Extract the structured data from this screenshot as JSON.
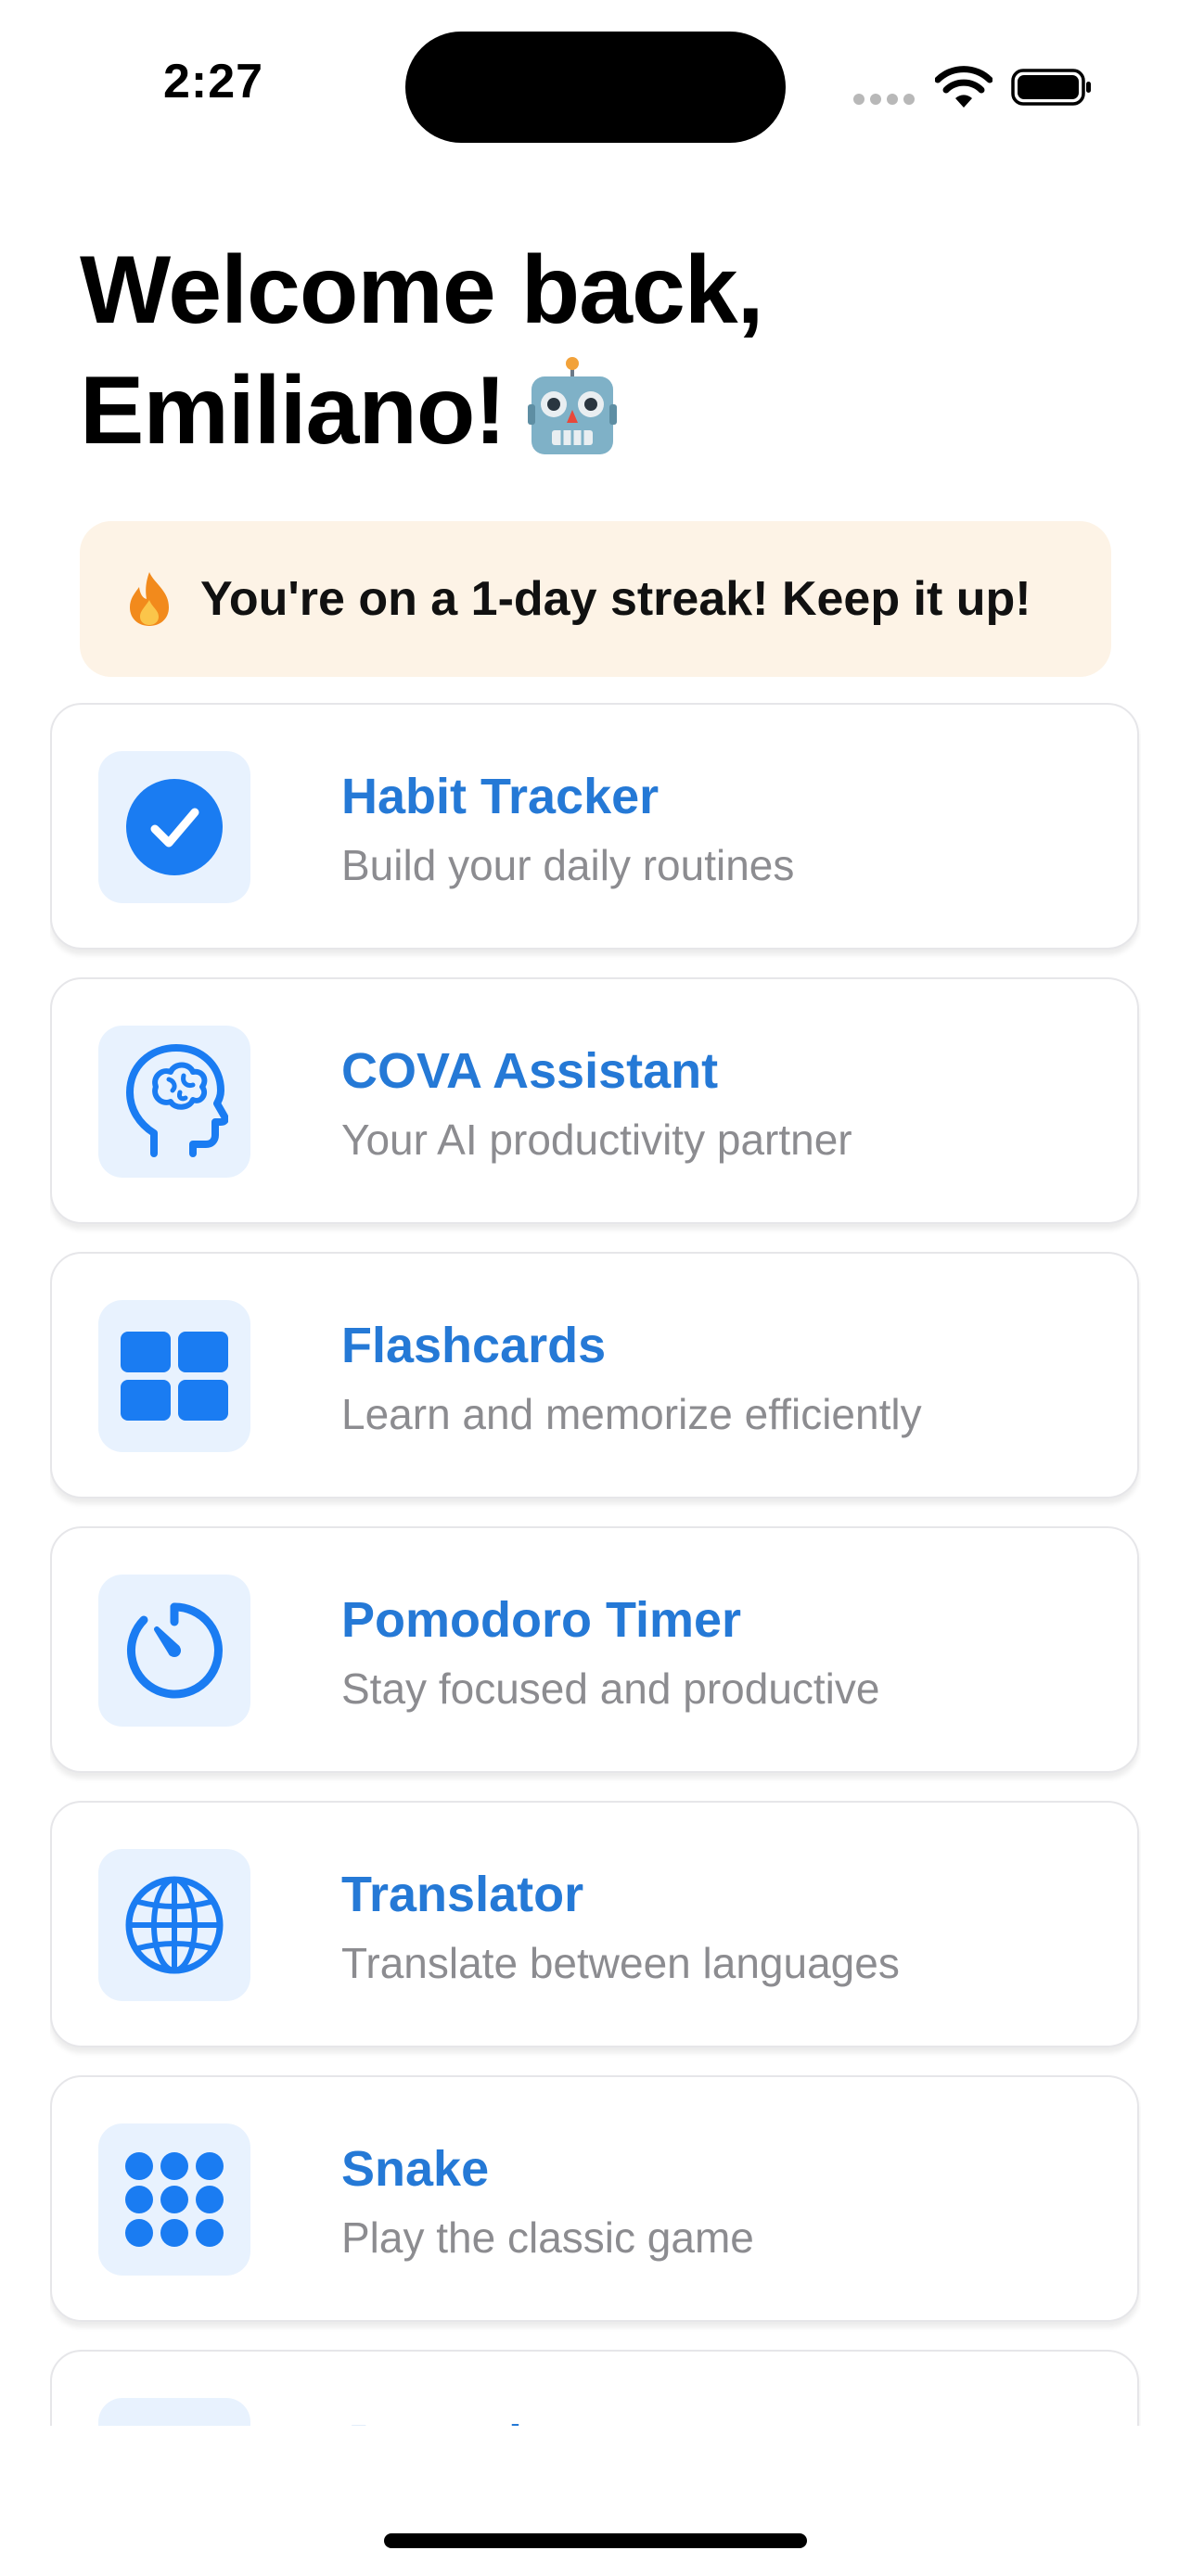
{
  "status_bar": {
    "time": "2:27"
  },
  "greeting": {
    "line1": "Welcome back,",
    "line2": "Emiliano!",
    "emoji": "🤖"
  },
  "streak": {
    "icon": "flame-icon",
    "text": "You're on a 1-day streak! Keep it up!"
  },
  "colors": {
    "accent": "#2579d6",
    "icon_blue": "#1a7cf2",
    "tile_bg": "#e8f2fe",
    "streak_bg": "#fdf3e6",
    "subtitle": "#8c8c90"
  },
  "features": [
    {
      "title": "Habit Tracker",
      "subtitle": "Build your daily routines",
      "icon": "checkmark-circle-icon"
    },
    {
      "title": "COVA Assistant",
      "subtitle": "Your AI productivity partner",
      "icon": "brain-head-icon"
    },
    {
      "title": "Flashcards",
      "subtitle": "Learn and memorize efficiently",
      "icon": "grid-squares-icon"
    },
    {
      "title": "Pomodoro Timer",
      "subtitle": "Stay focused and productive",
      "icon": "timer-icon"
    },
    {
      "title": "Translator",
      "subtitle": "Translate between languages",
      "icon": "globe-icon"
    },
    {
      "title": "Snake",
      "subtitle": "Play the classic game",
      "icon": "dots-grid-icon"
    },
    {
      "title": "Journal",
      "subtitle": "",
      "icon": "journal-icon"
    }
  ]
}
